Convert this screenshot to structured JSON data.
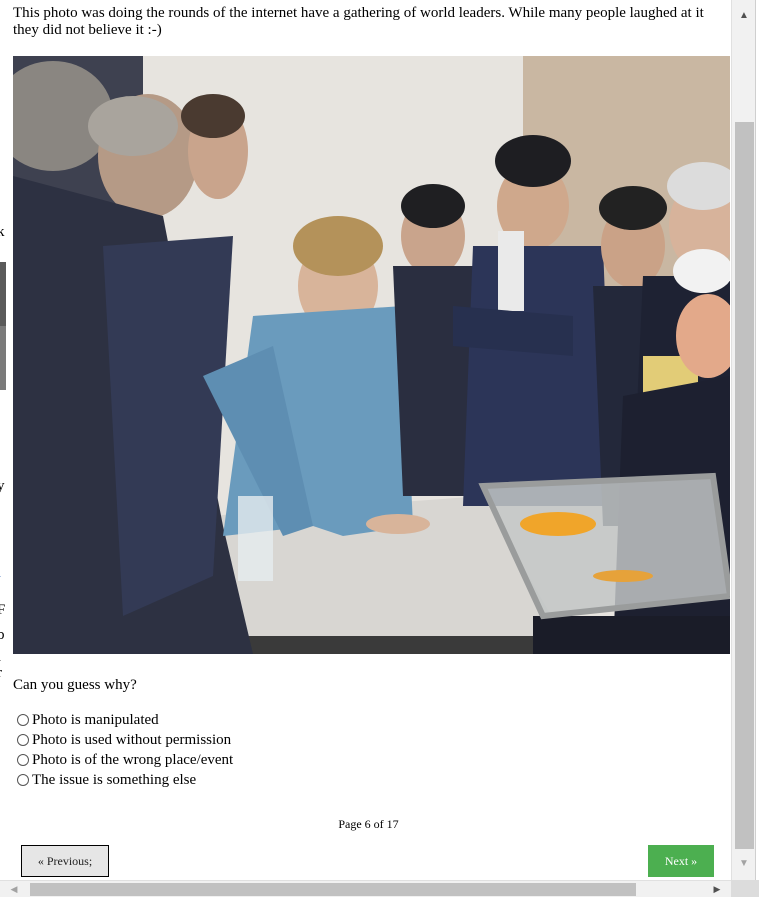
{
  "intro_text": "This photo was doing the rounds of the internet have a gathering of world leaders. While many people laughed at it they did not believe it :-)",
  "photo": {
    "alt_icon": "photo-image"
  },
  "question": "Can you guess why?",
  "options": [
    {
      "label": "Photo is manipulated",
      "selected": false
    },
    {
      "label": "Photo is used without permission",
      "selected": false
    },
    {
      "label": "Photo is of the wrong place/event",
      "selected": false
    },
    {
      "label": "The issue is something else",
      "selected": false
    }
  ],
  "pagination": {
    "indicator": "Page 6 of 17",
    "prev_label": "« Previous;",
    "next_label": "Next »"
  },
  "colors": {
    "next_button": "#4caf50",
    "prev_button": "#e6e6e6"
  },
  "scrollbars": {
    "up_icon": "▲",
    "down_icon": "▼",
    "left_icon": "◀",
    "right_icon": "▶"
  },
  "background_glyphs": [
    "k",
    "y",
    "l",
    "F",
    "b",
    "l",
    "r"
  ]
}
